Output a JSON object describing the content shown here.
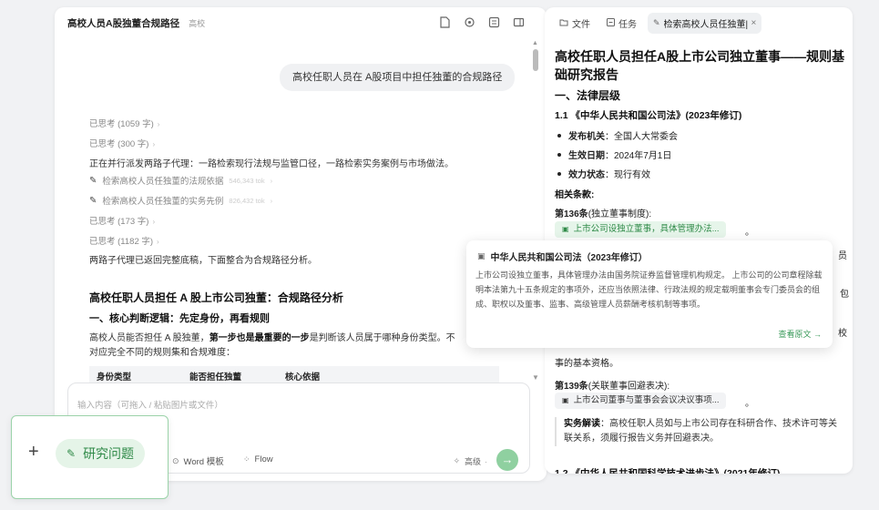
{
  "left": {
    "title": "高校人员A股独董合规路径",
    "tag": "高校",
    "header_icons": [
      "document-icon",
      "settings-icon",
      "preview-icon",
      "layout-icon"
    ],
    "user_message": "高校任职人员在 A股项目中担任独董的合规路径",
    "steps": [
      {
        "type": "think",
        "text": "已思考 (1059 字)"
      },
      {
        "type": "think",
        "text": "已思考 (300 字)"
      },
      {
        "type": "msg",
        "text": "正在并行派发两路子代理：一路检索现行法规与监管口径，一路检索实务案例与市场做法。"
      },
      {
        "type": "search",
        "text": "检索高校人员任独董的法规依据",
        "meta": "546,343 tok"
      },
      {
        "type": "search",
        "text": "检索高校人员任独董的实务先例",
        "meta": "826,432 tok"
      },
      {
        "type": "think",
        "text": "已思考 (173 字)"
      },
      {
        "type": "think",
        "text": "已思考 (1182 字)"
      },
      {
        "type": "msg",
        "text": "两路子代理已返回完整底稿，下面整合为合规路径分析。"
      }
    ],
    "answer_title": "高校任职人员担任 A 股上市公司独董：合规路径分析",
    "answer_h3": "一、核心判断逻辑：先定身份，再看规则",
    "para_pre": "高校人员能否担任 A 股独董，",
    "para_bold": "第一步也是最重要的一步",
    "para_post": "是判断该人员属于哪种身份类型。不",
    "para_line2": "对应完全不同的规则集和合规难度：",
    "table_headers": [
      "身份类型",
      "能否担任独董",
      "核心依据"
    ],
    "input_placeholder": "输入内容（可拖入 / 粘贴图片或文件）",
    "tools": [
      "Word 模板",
      "Flow"
    ],
    "model_label": "高级",
    "send_icon": "arrow-right-icon"
  },
  "action_card": {
    "plus": "+",
    "research_label": "研究问题"
  },
  "right": {
    "tabs": [
      {
        "label": "文件",
        "icon": "folder-icon"
      },
      {
        "label": "任务",
        "icon": "task-icon"
      },
      {
        "label": "检索高校人员任独董|",
        "icon": "pen-icon",
        "active": true
      }
    ],
    "title": "高校任职人员担任A股上市公司独立董事——规则基础研究报告",
    "h_legal": "一、法律层级",
    "h_company_law": "1.1 《中华人民共和国公司法》(2023年修订)",
    "items": [
      {
        "label": "发布机关",
        "value": "全国人大常委会"
      },
      {
        "label": "生效日期",
        "value": "2024年7月1日"
      },
      {
        "label": "效力状态",
        "value": "现行有效"
      }
    ],
    "related": "相关条款:",
    "art136": "第136条",
    "art136_note": "(独立董事制度):",
    "cite136": "上市公司设独立董事，具体管理办法...",
    "side_clip_1": "员",
    "side_clip_2": "包",
    "side_clip_3": "校",
    "overlap_text": "事的基本资格。",
    "art139": "第139条",
    "art139_note": "(关联董事回避表决):",
    "cite139": "上市公司董事与董事会会议决议事项...",
    "practice_label": "实务解读",
    "practice_text": "：高校任职人员如与上市公司存在科研合作、技术许可等关联关系，须履行报告义务并回避表决。",
    "h_tech_law": "1.2 《中华人民共和国科学技术进步法》(2021年修订)"
  },
  "popover": {
    "title": "中华人民共和国公司法（2023年修订）",
    "body": "上市公司设独立董事，具体管理办法由国务院证券监督管理机构规定。 上市公司的公司章程除载明本法第九十五条规定的事项外，还应当依照法律、行政法规的规定载明董事会专门委员会的组成、职权以及董事、监事、高级管理人员薪酬考核机制等事项。",
    "link": "查看原文 →"
  },
  "colors": {
    "accent": "#2f8a48",
    "accent_bg": "#e6f5ea",
    "send_btn": "#8fd0a0"
  }
}
